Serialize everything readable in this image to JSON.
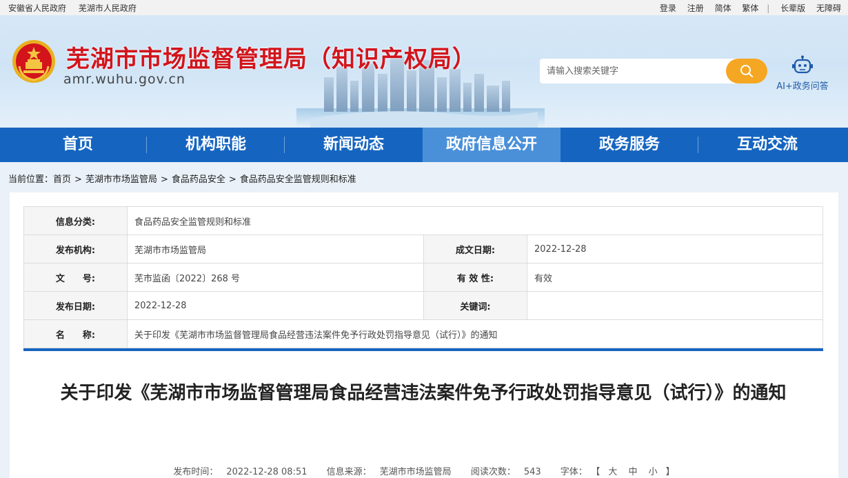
{
  "topbar": {
    "left_links": [
      "安徽省人民政府",
      "芜湖市人民政府"
    ],
    "login": "登录",
    "register": "注册",
    "simplified": "简体",
    "traditional": "繁体",
    "separator": "|",
    "elderly": "长辈版",
    "accessible": "无障碍"
  },
  "header": {
    "title": "芜湖市市场监督管理局（知识产权局）",
    "domain": "amr.wuhu.gov.cn",
    "search_placeholder": "请输入搜索关键字",
    "ai_label": "AI+政务问答"
  },
  "nav": {
    "items": [
      "首页",
      "机构职能",
      "新闻动态",
      "政府信息公开",
      "政务服务",
      "互动交流"
    ],
    "active_index": 3
  },
  "breadcrumb": {
    "prefix": "当前位置：",
    "items": [
      "首页",
      "芜湖市市场监管局",
      "食品药品安全",
      "食品药品安全监管规则和标准"
    ],
    "separator": ">"
  },
  "info": {
    "category_label": "信息分类:",
    "category_value": "食品药品安全监管规则和标准",
    "publisher_label": "发布机构:",
    "publisher_value": "芜湖市市场监管局",
    "written_date_label": "成文日期:",
    "written_date_value": "2022-12-28",
    "doc_no_label": "文　　号:",
    "doc_no_value": "芜市监函〔2022〕268 号",
    "validity_label": "有 效 性:",
    "validity_value": "有效",
    "publish_date_label": "发布日期:",
    "publish_date_value": "2022-12-28",
    "keywords_label": "关键词:",
    "keywords_value": "",
    "name_label": "名　　称:",
    "name_value": "关于印发《芜湖市市场监督管理局食品经营违法案件免予行政处罚指导意见（试行）》的通知"
  },
  "article": {
    "title": "关于印发《芜湖市市场监督管理局食品经营违法案件免予行政处罚指导意见（试行）》的通知",
    "publish_time_label": "发布时间：",
    "publish_time": "2022-12-28 08:51",
    "source_label": "信息来源：",
    "source": "芜湖市市场监管局",
    "views_label": "阅读次数：",
    "views": "543",
    "font_label": "字体：",
    "font_open": "【",
    "font_large": "大",
    "font_medium": "中",
    "font_small": "小",
    "font_close": "】"
  },
  "colors": {
    "nav_bg": "#1565c0",
    "nav_active": "#4a90d9",
    "title_red": "#d3141b",
    "search_btn": "#f5a623"
  },
  "icons": [
    "national-emblem-icon",
    "search-icon",
    "ai-robot-icon"
  ]
}
